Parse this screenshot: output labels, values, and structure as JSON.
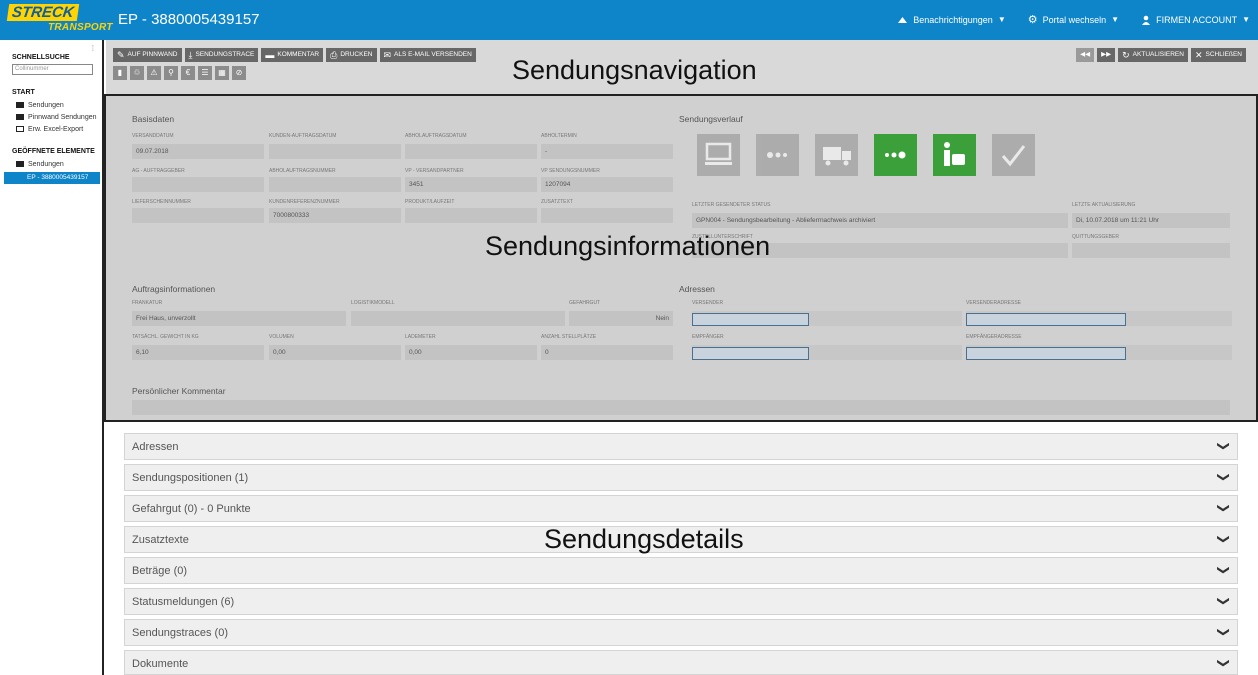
{
  "header": {
    "logo_top": "STRECK",
    "logo_bottom": "TRANSPORT",
    "title": "EP - 3880005439157",
    "notifications": "Benachrichtigungen",
    "portal": "Portal wechseln",
    "account": "FIRMEN ACCOUNT"
  },
  "sidebar": {
    "quicksearch_title": "SCHNELLSUCHE",
    "quicksearch_placeholder": "Collinummer",
    "start_title": "START",
    "start_items": [
      "Sendungen",
      "Pinnwand Sendungen",
      "Erw. Excel-Export"
    ],
    "open_title": "GEÖFFNETE ELEMENTE",
    "open_items": [
      "Sendungen"
    ],
    "open_active": "EP - 3880005439157"
  },
  "toolbar": {
    "buttons": [
      "AUF PINNWAND",
      "SENDUNGSTRACE",
      "KOMMENTAR",
      "DRUCKEN",
      "ALS E-MAIL VERSENDEN"
    ],
    "icons": [
      "▮",
      "♲",
      "⚠",
      "⚲",
      "€",
      "☰",
      "▦",
      "⊘"
    ],
    "right_buttons": [
      "AKTUALISIEREN",
      "SCHLIEßEN"
    ]
  },
  "overlays": {
    "nav": "Sendungsnavigation",
    "info": "Sendungsinformationen",
    "details": "Sendungsdetails"
  },
  "basis": {
    "title": "Basisdaten",
    "labels": [
      "VERSANDDATUM",
      "KUNDEN-AUFTRAGSDATUM",
      "ABHOLAUFTRAGSDATUM",
      "ABHOLTERMIN",
      "AG - AUFTRAGGEBER",
      "ABHOLAUFTRAGSNUMMER",
      "VP - VERSANDPARTNER",
      "VP SENDUNGSNUMMER",
      "LIEFERSCHEINNUMMER",
      "KUNDENREFERENZNUMMER",
      "PRODUKT/LAUFZEIT",
      "ZUSATZTEXT"
    ],
    "values": [
      "09.07.2018",
      "",
      "",
      "-",
      "",
      "",
      "3451",
      "1207094",
      "",
      "7000800333",
      "",
      ""
    ]
  },
  "verlauf": {
    "title": "Sendungsverlauf",
    "status_label": "LETZTER GESENDETER STATUS",
    "status_value": "GPN004 - Sendungsbearbeitung - Ablieferrnachweis archiviert",
    "update_label": "LETZTE AKTUALISIERUNG",
    "update_value": "Di, 10.07.2018 um 11:21 Uhr",
    "receipt_label": "QUITTUNGSGEBER",
    "hidden_label": "ZUSTELLUNTERSCHRIFT"
  },
  "auftrag": {
    "title": "Auftragsinformationen",
    "labels": [
      "FRANKATUR",
      "LOGISTIKMODELL",
      "GEFAHRGUT",
      "TATSÄCHL. GEWICHT IN KG",
      "VOLUMEN",
      "LADEMETER",
      "ANZAHL STELLPLÄTZE"
    ],
    "values": [
      "Frei Haus, unverzollt",
      "",
      "Nein",
      "6,10",
      "0,00",
      "0,00",
      "0"
    ]
  },
  "adressen": {
    "title": "Adressen",
    "labels": [
      "VERSENDER",
      "VERSENDERADRESSE",
      "EMPFÄNGER",
      "EMPFÄNGERADRESSE"
    ]
  },
  "comment": {
    "title": "Persönlicher Kommentar"
  },
  "accordion": [
    "Adressen",
    "Sendungspositionen (1)",
    "Gefahrgut (0) - 0 Punkte",
    "Zusatztexte",
    "Beträge (0)",
    "Statusmeldungen (6)",
    "Sendungstraces (0)",
    "Dokumente"
  ],
  "colors": {
    "brand": "#0e84c9",
    "accent": "#ffd400",
    "active_status": "#3ca03a"
  }
}
